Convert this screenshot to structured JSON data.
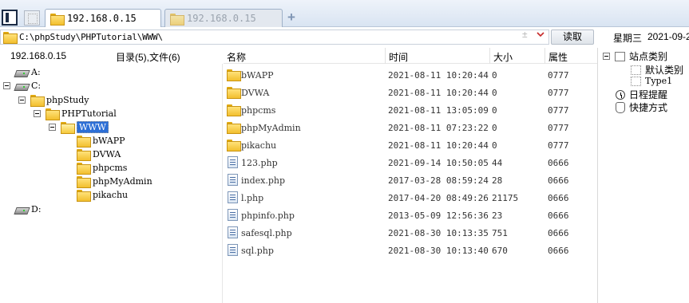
{
  "tabs": [
    {
      "label": "192.168.0.15",
      "active": true
    },
    {
      "label": "192.168.0.15",
      "active": false
    }
  ],
  "address": {
    "path": "C:\\phpStudy\\PHPTutorial\\WWW\\",
    "plus_minus": "±",
    "read_button": "读取"
  },
  "clock": {
    "weekday": "星期三",
    "date": "2021-09-2"
  },
  "left": {
    "server": "192.168.0.15",
    "summary": "目录(5),文件(6)",
    "tree": [
      {
        "label": "A:",
        "type": "drive"
      },
      {
        "label": "C:",
        "type": "drive"
      },
      {
        "label": "phpStudy",
        "type": "folder"
      },
      {
        "label": "PHPTutorial",
        "type": "folder"
      },
      {
        "label": "WWW",
        "type": "folder-open"
      },
      {
        "label": "bWAPP",
        "type": "folder"
      },
      {
        "label": "DVWA",
        "type": "folder"
      },
      {
        "label": "phpcms",
        "type": "folder"
      },
      {
        "label": "phpMyAdmin",
        "type": "folder"
      },
      {
        "label": "pikachu",
        "type": "folder"
      },
      {
        "label": "D:",
        "type": "drive"
      }
    ]
  },
  "files": {
    "columns": {
      "name": "名称",
      "time": "时间",
      "size": "大小",
      "attr": "属性"
    },
    "rows": [
      {
        "name": "bWAPP",
        "type": "folder",
        "time": "2021-08-11 10:20:44",
        "size": "0",
        "attr": "0777"
      },
      {
        "name": "DVWA",
        "type": "folder",
        "time": "2021-08-11 10:20:44",
        "size": "0",
        "attr": "0777"
      },
      {
        "name": "phpcms",
        "type": "folder",
        "time": "2021-08-11 13:05:09",
        "size": "0",
        "attr": "0777"
      },
      {
        "name": "phpMyAdmin",
        "type": "folder",
        "time": "2021-08-11 07:23:22",
        "size": "0",
        "attr": "0777"
      },
      {
        "name": "pikachu",
        "type": "folder",
        "time": "2021-08-11 10:20:44",
        "size": "0",
        "attr": "0777"
      },
      {
        "name": "123.php",
        "type": "file",
        "time": "2021-09-14 10:50:05",
        "size": "44",
        "attr": "0666"
      },
      {
        "name": "index.php",
        "type": "file",
        "time": "2017-03-28 08:59:24",
        "size": "28",
        "attr": "0666"
      },
      {
        "name": "l.php",
        "type": "file",
        "time": "2017-04-20 08:49:26",
        "size": "21175",
        "attr": "0666"
      },
      {
        "name": "phpinfo.php",
        "type": "file",
        "time": "2013-05-09 12:56:36",
        "size": "23",
        "attr": "0666"
      },
      {
        "name": "safesql.php",
        "type": "file",
        "time": "2021-08-30 10:13:35",
        "size": "751",
        "attr": "0666"
      },
      {
        "name": "sql.php",
        "type": "file",
        "time": "2021-08-30 10:13:40",
        "size": "670",
        "attr": "0666"
      }
    ]
  },
  "right": {
    "site_category": "站点类别",
    "default_category": "默认类别",
    "type1": "Type1",
    "schedule": "日程提醒",
    "shortcut": "快捷方式"
  },
  "colors": {
    "selection": "#2d6fd6",
    "folder": "#f2bf2e",
    "accent": "#c62828"
  }
}
